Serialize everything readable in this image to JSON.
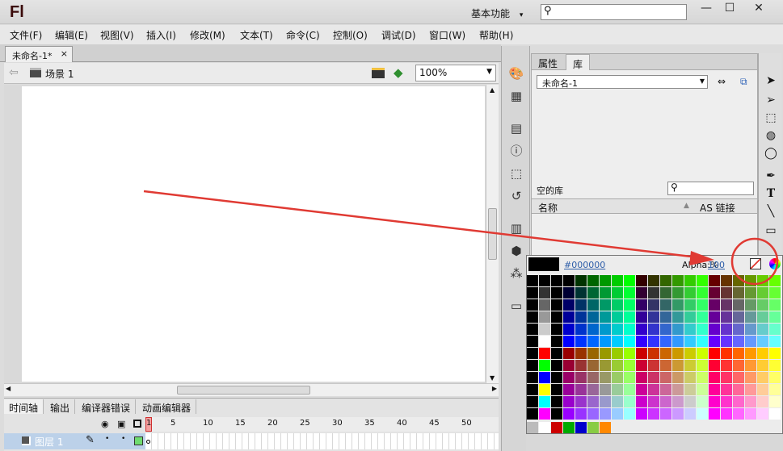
{
  "app": {
    "logo": "Fl",
    "workspace": "基本功能",
    "workspace_caret": "▾"
  },
  "window": {
    "minimize": "—",
    "maximize": "☐",
    "close": "✕"
  },
  "menu": [
    "文件(F)",
    "编辑(E)",
    "视图(V)",
    "插入(I)",
    "修改(M)",
    "文本(T)",
    "命令(C)",
    "控制(O)",
    "调试(D)",
    "窗口(W)",
    "帮助(H)"
  ],
  "doc": {
    "tab": "未命名-1*",
    "close": "×",
    "scene": "场景 1",
    "zoom": "100%"
  },
  "timeline": {
    "tabs": [
      "时间轴",
      "输出",
      "编译器错误",
      "动画编辑器"
    ],
    "frames": [
      "1",
      "5",
      "10",
      "15",
      "20",
      "25",
      "30",
      "35",
      "40",
      "45",
      "50"
    ],
    "layer": "图层 1"
  },
  "library": {
    "tabs": [
      "属性",
      "库"
    ],
    "doc_select": "未命名-1",
    "empty": "空的库",
    "col_name": "名称",
    "col_link": "AS 链接"
  },
  "picker": {
    "hex": "#000000",
    "alpha_label": "Alpha:%",
    "alpha_value": "100"
  },
  "colors": {
    "accent_red": "#e03a33",
    "swatch_black": "#000000"
  },
  "icons": [
    "search-icon",
    "back-arrow-icon",
    "scene-icon",
    "edit-symbols-icon",
    "edit-scene-icon",
    "palette-icon",
    "grid-icon",
    "align-icon",
    "info-icon",
    "transform-icon",
    "motion-presets-icon",
    "components-icon",
    "library-icon",
    "selection-tool-icon",
    "subselection-tool-icon",
    "free-transform-icon",
    "3d-rotation-icon",
    "lasso-icon",
    "pen-icon",
    "text-tool-icon",
    "line-tool-icon",
    "rectangle-tool-icon",
    "no-color-icon",
    "color-wheel-icon",
    "eye-icon",
    "lock-icon",
    "outline-icon",
    "pencil-icon"
  ]
}
